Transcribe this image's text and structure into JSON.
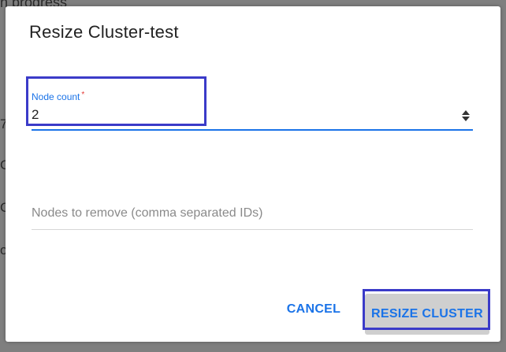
{
  "background": {
    "top_text": "n progress",
    "fragments": [
      "7",
      "C",
      "C",
      "ol"
    ]
  },
  "dialog": {
    "title": "Resize Cluster-test",
    "node_count": {
      "label": "Node count",
      "required_mark": "*",
      "value": "2"
    },
    "nodes_to_remove": {
      "value": "",
      "placeholder": "Nodes to remove (comma separated IDs)"
    },
    "actions": {
      "cancel_label": "CANCEL",
      "resize_label": "RESIZE CLUSTER"
    }
  },
  "colors": {
    "accent": "#1a73e8",
    "required": "#e53935",
    "highlight": "#3b3bc8"
  }
}
